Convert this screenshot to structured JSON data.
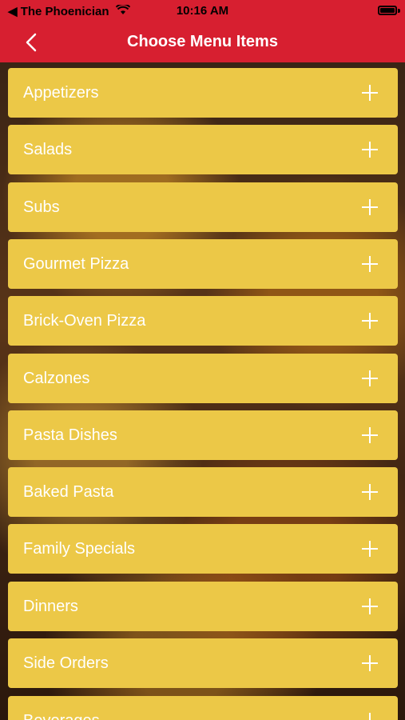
{
  "status_bar": {
    "back_app": "◀ The Phoenician",
    "time": "10:16 AM"
  },
  "nav": {
    "title": "Choose Menu Items",
    "back_icon": "chevron-left-icon"
  },
  "colors": {
    "header": "#d71f30",
    "row_bg": "#ecc847",
    "row_text": "#ffffff"
  },
  "menu_items": [
    {
      "label": "Appetizers"
    },
    {
      "label": "Salads"
    },
    {
      "label": "Subs"
    },
    {
      "label": "Gourmet Pizza"
    },
    {
      "label": "Brick-Oven Pizza"
    },
    {
      "label": "Calzones"
    },
    {
      "label": "Pasta Dishes"
    },
    {
      "label": "Baked Pasta"
    },
    {
      "label": "Family Specials"
    },
    {
      "label": "Dinners"
    },
    {
      "label": "Side Orders"
    },
    {
      "label": "Beverages"
    }
  ]
}
